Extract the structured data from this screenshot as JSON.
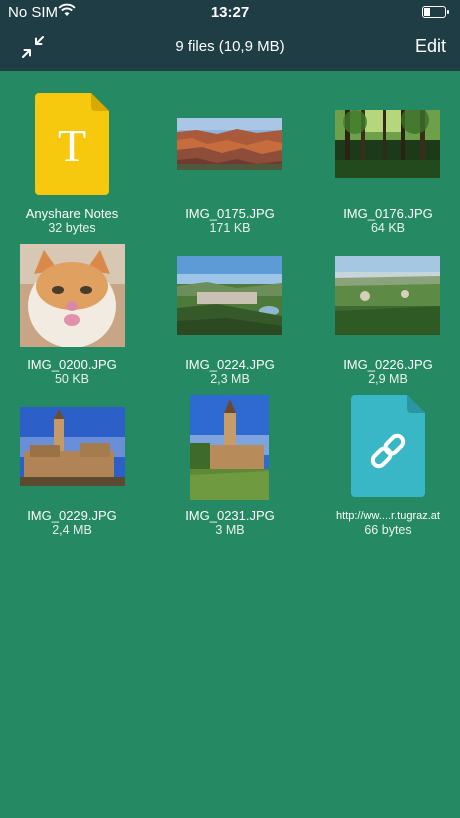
{
  "status": {
    "carrier": "No SIM",
    "time": "13:27"
  },
  "nav": {
    "title": "9 files (10,9 MB)",
    "edit_label": "Edit",
    "left_icon": "collapse-arrows-icon"
  },
  "colors": {
    "background": "#258a63",
    "topbar": "#1f3d45",
    "note_yellow": "#f6c90e",
    "link_teal": "#3ab7c6"
  },
  "files": [
    {
      "name": "Anyshare Notes",
      "size": "32 bytes",
      "type": "note",
      "icon_letter": "T"
    },
    {
      "name": "IMG_0175.JPG",
      "size": "171 KB",
      "type": "image",
      "scene": "canyon"
    },
    {
      "name": "IMG_0176.JPG",
      "size": "64 KB",
      "type": "image",
      "scene": "forest"
    },
    {
      "name": "IMG_0200.JPG",
      "size": "50 KB",
      "type": "image",
      "scene": "cat"
    },
    {
      "name": "IMG_0224.JPG",
      "size": "2,3 MB",
      "type": "image",
      "scene": "valley-town"
    },
    {
      "name": "IMG_0226.JPG",
      "size": "2,9 MB",
      "type": "image",
      "scene": "hill-panorama"
    },
    {
      "name": "IMG_0229.JPG",
      "size": "2,4 MB",
      "type": "image",
      "scene": "castle-wide"
    },
    {
      "name": "IMG_0231.JPG",
      "size": "3 MB",
      "type": "image",
      "scene": "castle-tall"
    },
    {
      "name": "http://ww....r.tugraz.at",
      "size": "66 bytes",
      "type": "link"
    }
  ]
}
